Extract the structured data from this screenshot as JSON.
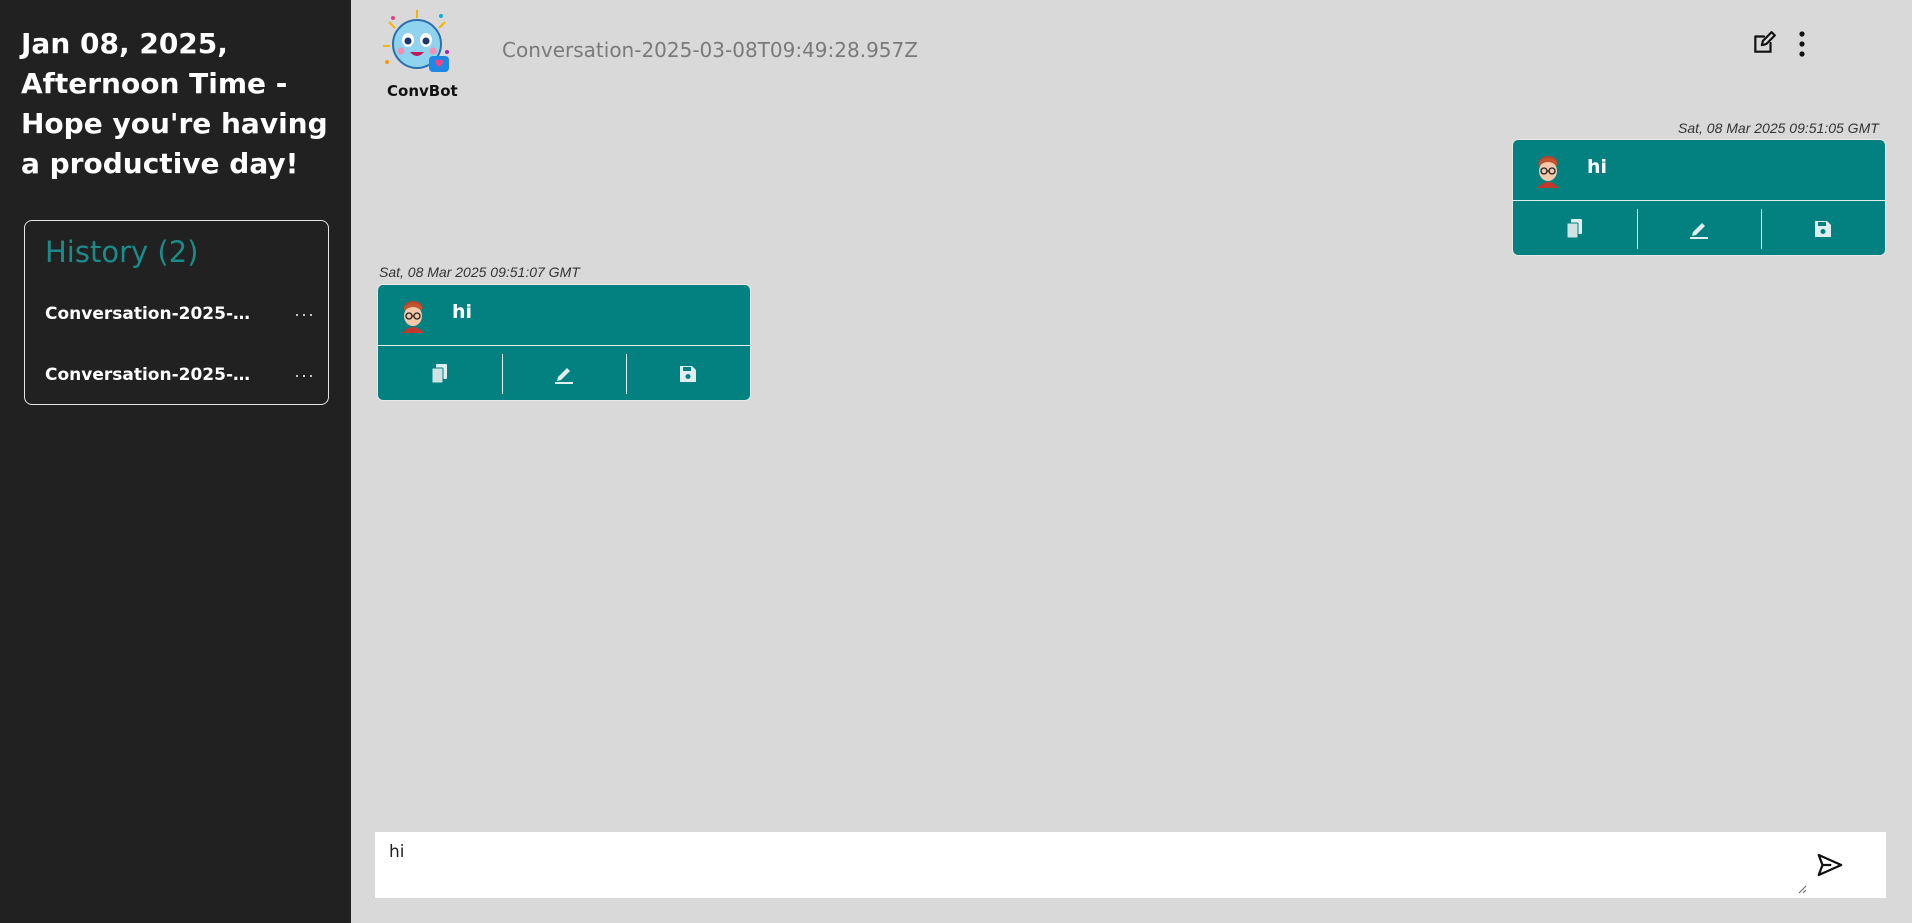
{
  "sidebar": {
    "greeting": "Jan 08, 2025, Afternoon Time - Hope you're having a productive day!",
    "history": {
      "title": "History (2)",
      "items": [
        {
          "label": "Conversation-2025-03-...",
          "menu": "···"
        },
        {
          "label": "Conversation-2025-03-...",
          "menu": "···"
        }
      ]
    }
  },
  "header": {
    "bot_name": "ConvBot",
    "conversation_title": "Conversation-2025-03-08T09:49:28.957Z",
    "icons": [
      "edit-icon",
      "more-vertical-icon"
    ]
  },
  "messages": [
    {
      "timestamp": "Sat, 08 Mar 2025 09:51:05 GMT",
      "text": "hi",
      "align": "right",
      "actions": [
        "copy-icon",
        "edit-icon",
        "save-icon"
      ]
    },
    {
      "timestamp": "Sat, 08 Mar 2025 09:51:07 GMT",
      "text": "hi",
      "align": "left",
      "actions": [
        "copy-icon",
        "edit-icon",
        "save-icon"
      ]
    }
  ],
  "composer": {
    "value": "hi",
    "send_icon": "send-icon"
  },
  "colors": {
    "sidebar_bg": "#212121",
    "main_bg": "#d9d9d9",
    "accent": "#038080",
    "history_title": "#1a8a8a"
  }
}
